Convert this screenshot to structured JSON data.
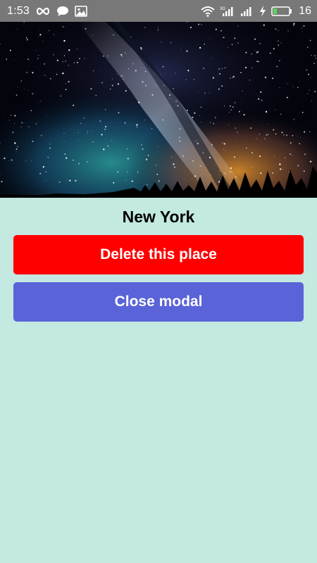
{
  "status_bar": {
    "time": "1:53",
    "left_icons": [
      "infinity-icon",
      "chat-bubble-icon",
      "image-icon"
    ],
    "right_icons": [
      "wifi-icon",
      "signal-3g-icon",
      "signal-icon",
      "charging-icon",
      "battery-icon"
    ],
    "network_label": "3G",
    "battery_level": "16"
  },
  "hero_image": {
    "description_icon": "milky-way-photo"
  },
  "place": {
    "name": "New York"
  },
  "actions": {
    "delete_label": "Delete this place",
    "close_label": "Close modal"
  },
  "colors": {
    "background": "#c3e9e0",
    "status_bar": "#787878",
    "delete_button": "#fe0000",
    "close_button": "#5a63d8",
    "button_text": "#ffffff"
  }
}
